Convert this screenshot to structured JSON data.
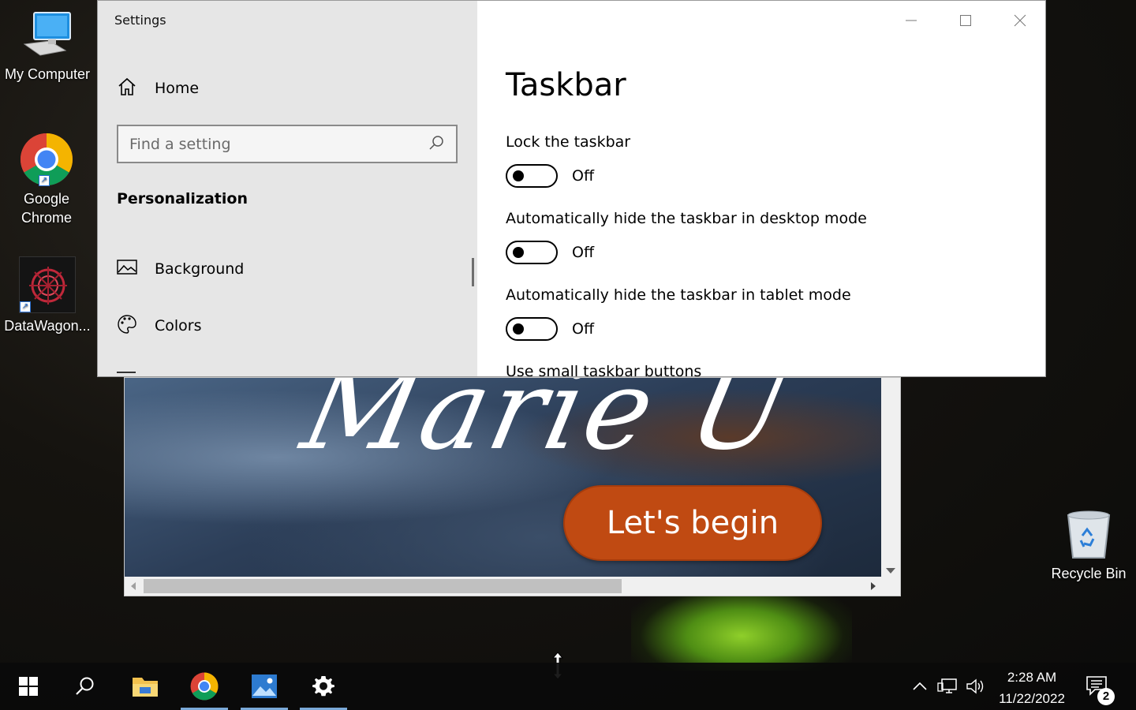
{
  "desktop": {
    "icons": [
      {
        "label": "My Computer",
        "icon": "computer-icon"
      },
      {
        "label": "Google Chrome",
        "icon": "chrome-icon"
      },
      {
        "label": "DataWagon...",
        "icon": "datawagon-icon"
      },
      {
        "label": "Recycle Bin",
        "icon": "recycle-bin-icon"
      }
    ]
  },
  "background_window": {
    "script_text": "Marie U",
    "begin_button": "Let's begin"
  },
  "settings": {
    "title": "Settings",
    "nav": {
      "home_label": "Home",
      "search_placeholder": "Find a setting",
      "section": "Personalization",
      "items": [
        {
          "label": "Background",
          "icon": "picture-icon"
        },
        {
          "label": "Colors",
          "icon": "palette-icon"
        }
      ]
    },
    "page": {
      "title": "Taskbar",
      "settings": [
        {
          "label": "Lock the taskbar",
          "state": "Off"
        },
        {
          "label": "Automatically hide the taskbar in desktop mode",
          "state": "Off"
        },
        {
          "label": "Automatically hide the taskbar in tablet mode",
          "state": "Off"
        },
        {
          "label": "Use small taskbar buttons"
        }
      ]
    }
  },
  "taskbar": {
    "apps": [
      "start-icon",
      "search-icon",
      "file-explorer-icon",
      "chrome-icon",
      "photos-icon",
      "settings-gear-icon"
    ],
    "clock_time": "2:28 AM",
    "clock_date": "11/22/2022",
    "notification_count": "2"
  },
  "colors": {
    "accent": "#7aa9d8",
    "button_orange": "#c04a12"
  }
}
